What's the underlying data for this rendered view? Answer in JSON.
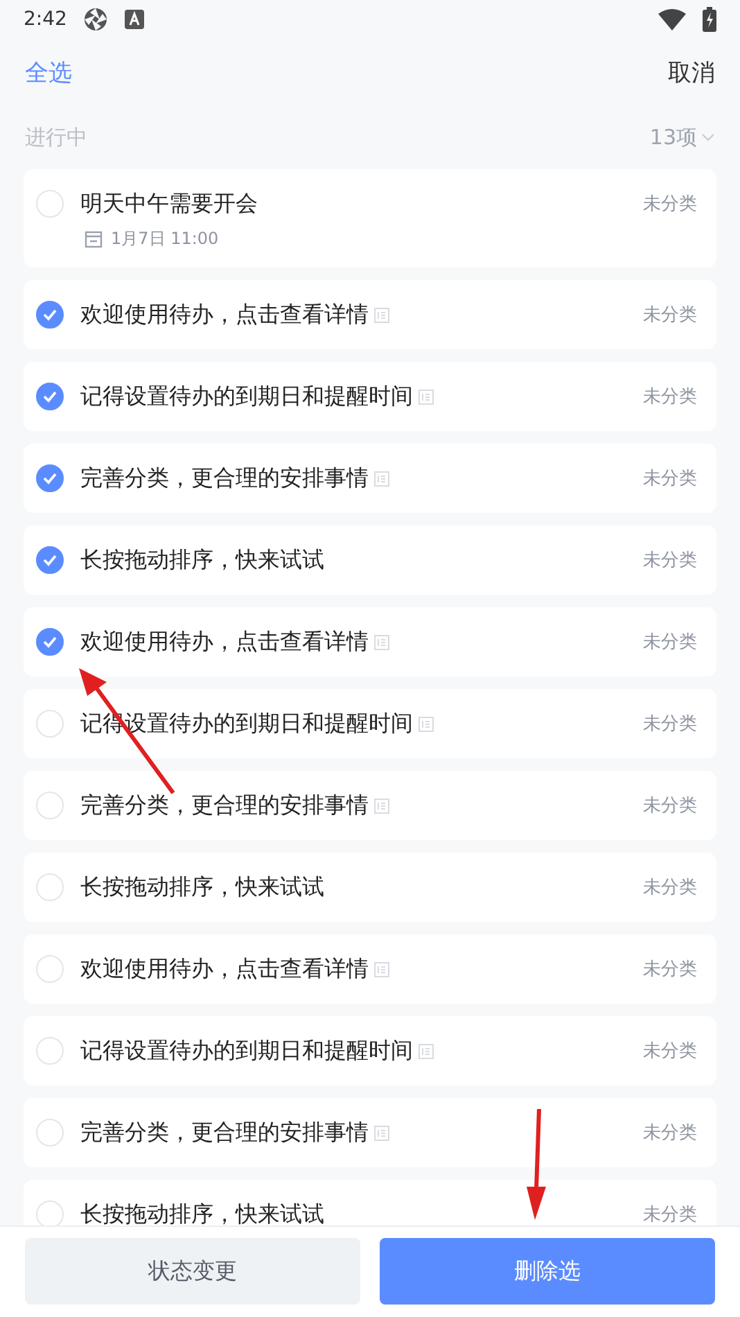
{
  "status_bar": {
    "time": "2:42"
  },
  "header": {
    "select_all": "全选",
    "cancel": "取消"
  },
  "section": {
    "title": "进行中",
    "count": "13项"
  },
  "todos": [
    {
      "title": "明天中午需要开会",
      "checked": false,
      "note": false,
      "category": "未分类",
      "due": "1月7日 11:00"
    },
    {
      "title": "欢迎使用待办，点击查看详情",
      "checked": true,
      "note": true,
      "category": "未分类"
    },
    {
      "title": "记得设置待办的到期日和提醒时间",
      "checked": true,
      "note": true,
      "category": "未分类"
    },
    {
      "title": "完善分类，更合理的安排事情",
      "checked": true,
      "note": true,
      "category": "未分类"
    },
    {
      "title": "长按拖动排序，快来试试",
      "checked": true,
      "note": false,
      "category": "未分类"
    },
    {
      "title": "欢迎使用待办，点击查看详情",
      "checked": true,
      "note": true,
      "category": "未分类"
    },
    {
      "title": "记得设置待办的到期日和提醒时间",
      "checked": false,
      "note": true,
      "category": "未分类"
    },
    {
      "title": "完善分类，更合理的安排事情",
      "checked": false,
      "note": true,
      "category": "未分类"
    },
    {
      "title": "长按拖动排序，快来试试",
      "checked": false,
      "note": false,
      "category": "未分类"
    },
    {
      "title": "欢迎使用待办，点击查看详情",
      "checked": false,
      "note": true,
      "category": "未分类"
    },
    {
      "title": "记得设置待办的到期日和提醒时间",
      "checked": false,
      "note": true,
      "category": "未分类"
    },
    {
      "title": "完善分类，更合理的安排事情",
      "checked": false,
      "note": true,
      "category": "未分类"
    },
    {
      "title": "长按拖动排序，快来试试",
      "checked": false,
      "note": false,
      "category": "未分类"
    }
  ],
  "bottom_bar": {
    "buttons": [
      {
        "label": "状态变更",
        "kind": "secondary"
      },
      {
        "label": "删除选",
        "kind": "primary"
      }
    ]
  }
}
